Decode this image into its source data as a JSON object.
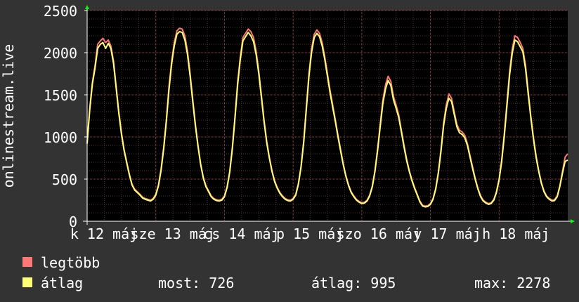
{
  "chart_data": {
    "type": "line",
    "ylabel": "onlinestream.live",
    "ylim": [
      0,
      2500
    ],
    "y_ticks": [
      "0",
      "500",
      "1000",
      "1500",
      "2000",
      "2500"
    ],
    "x_tick_labels": [
      "k 12 máj",
      "sze 13 máj",
      "cs 14 máj",
      "p 15 máj",
      "szo 16 máj",
      "v 17 máj",
      "h 18 máj"
    ],
    "grid": true,
    "series": [
      {
        "name": "legtöbb",
        "color": "#ff7777",
        "values": [
          940,
          1350,
          1650,
          1850,
          2100,
          2140,
          2170,
          2120,
          2150,
          2080,
          1900,
          1600,
          1300,
          1050,
          850,
          700,
          560,
          440,
          380,
          350,
          320,
          285,
          270,
          260,
          250,
          270,
          320,
          430,
          620,
          880,
          1200,
          1600,
          1900,
          2120,
          2260,
          2290,
          2280,
          2200,
          2020,
          1750,
          1450,
          1150,
          900,
          680,
          520,
          420,
          360,
          300,
          270,
          255,
          250,
          260,
          300,
          410,
          590,
          880,
          1250,
          1650,
          1950,
          2180,
          2230,
          2280,
          2250,
          2180,
          2020,
          1780,
          1500,
          1200,
          950,
          760,
          600,
          480,
          400,
          340,
          300,
          270,
          255,
          250,
          270,
          320,
          450,
          650,
          950,
          1350,
          1750,
          2050,
          2220,
          2270,
          2230,
          2120,
          1950,
          1750,
          1550,
          1380,
          1200,
          1020,
          850,
          680,
          540,
          430,
          350,
          300,
          260,
          235,
          220,
          225,
          250,
          310,
          420,
          600,
          860,
          1160,
          1440,
          1620,
          1720,
          1660,
          1480,
          1380,
          1260,
          1080,
          900,
          740,
          600,
          490,
          400,
          320,
          240,
          190,
          180,
          185,
          210,
          270,
          390,
          580,
          850,
          1170,
          1380,
          1510,
          1460,
          1300,
          1150,
          1080,
          1060,
          1020,
          920,
          780,
          640,
          500,
          390,
          300,
          250,
          225,
          210,
          220,
          260,
          350,
          500,
          730,
          1050,
          1420,
          1780,
          2050,
          2200,
          2180,
          2120,
          2050,
          1850,
          1550,
          1250,
          1000,
          780,
          600,
          460,
          360,
          300,
          270,
          250,
          255,
          300,
          420,
          590,
          760,
          800
        ]
      },
      {
        "name": "átlag",
        "color": "#ffff77",
        "values": [
          920,
          1330,
          1630,
          1820,
          2050,
          2100,
          2120,
          2050,
          2110,
          2050,
          1870,
          1580,
          1280,
          1030,
          840,
          690,
          550,
          430,
          370,
          340,
          310,
          275,
          260,
          250,
          240,
          260,
          310,
          420,
          600,
          860,
          1180,
          1560,
          1870,
          2080,
          2220,
          2250,
          2240,
          2150,
          1980,
          1720,
          1420,
          1130,
          890,
          670,
          510,
          410,
          350,
          290,
          260,
          245,
          240,
          250,
          290,
          400,
          580,
          860,
          1230,
          1620,
          1920,
          2140,
          2190,
          2240,
          2200,
          2130,
          1980,
          1750,
          1470,
          1180,
          930,
          750,
          590,
          470,
          390,
          330,
          290,
          260,
          245,
          240,
          260,
          310,
          440,
          640,
          930,
          1320,
          1720,
          2010,
          2180,
          2230,
          2190,
          2080,
          1920,
          1720,
          1520,
          1350,
          1180,
          1000,
          830,
          670,
          530,
          420,
          340,
          290,
          250,
          225,
          210,
          215,
          240,
          300,
          410,
          590,
          840,
          1130,
          1400,
          1570,
          1670,
          1610,
          1440,
          1340,
          1230,
          1060,
          880,
          720,
          590,
          480,
          390,
          310,
          230,
          180,
          170,
          175,
          200,
          260,
          380,
          570,
          830,
          1140,
          1340,
          1460,
          1420,
          1270,
          1120,
          1050,
          1030,
          990,
          900,
          760,
          620,
          490,
          380,
          290,
          240,
          215,
          200,
          210,
          250,
          340,
          490,
          710,
          1020,
          1380,
          1740,
          2000,
          2150,
          2130,
          2070,
          2010,
          1810,
          1520,
          1230,
          980,
          760,
          590,
          450,
          350,
          290,
          260,
          240,
          245,
          290,
          410,
          570,
          710,
          726
        ]
      }
    ]
  },
  "legend": {
    "items": [
      {
        "label": "legtöbb",
        "color": "#ff7777"
      },
      {
        "label": "átlag",
        "color": "#ffff77"
      }
    ],
    "stats": {
      "most": "most: 726",
      "atlag": "átlag: 995",
      "max": "max: 2278"
    }
  }
}
